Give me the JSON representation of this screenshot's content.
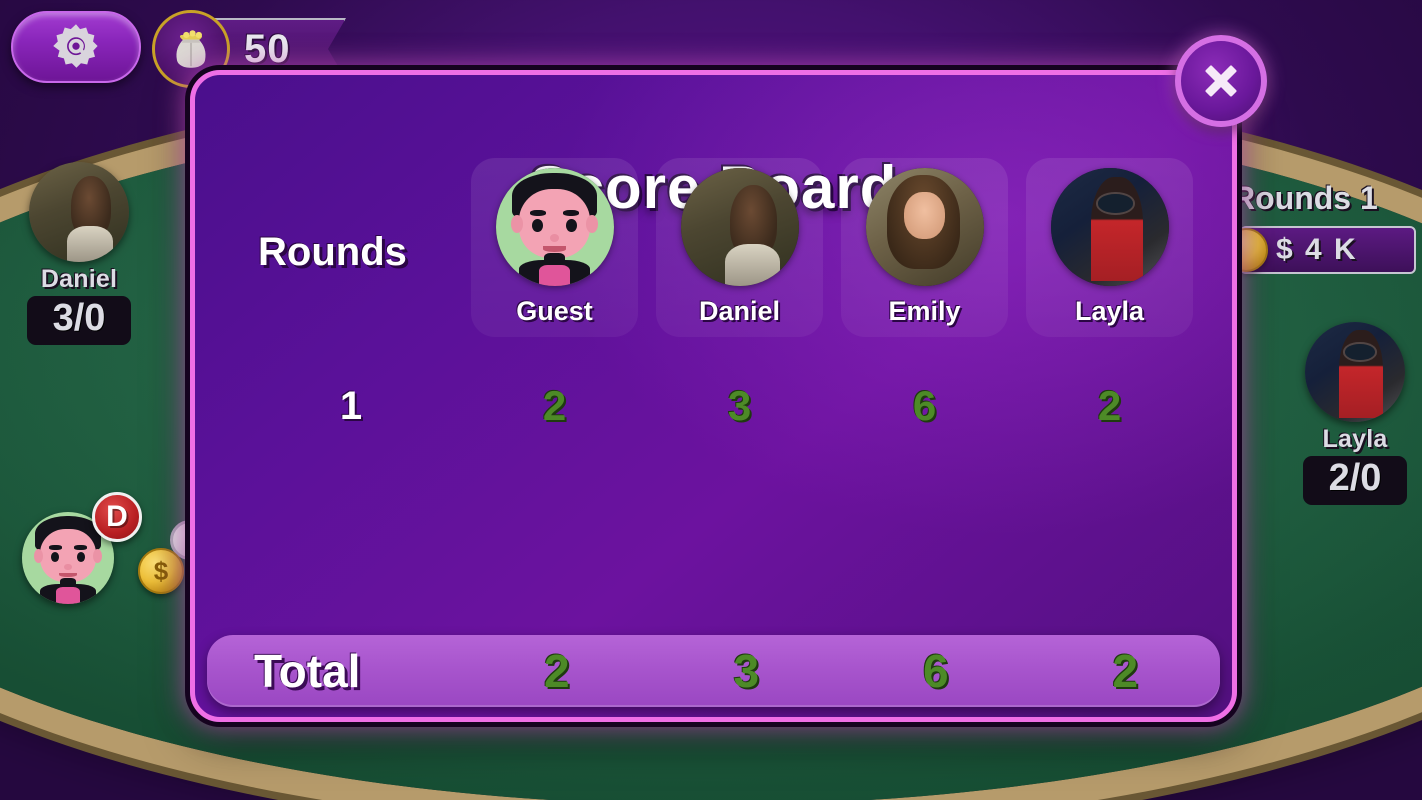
{
  "hud": {
    "settings_icon": "gear-icon",
    "coin_bag_icon": "coin-bag-icon",
    "coin_count": "50",
    "rounds_indicator": "Rounds 1",
    "pot_value": "$ 4 K",
    "pot_coin_icon": "gold-coin-icon",
    "dealer_badge": "D",
    "players": [
      {
        "name": "Daniel",
        "score": "3/0",
        "avatar": "av-daniel",
        "position": "left"
      },
      {
        "name": "Layla",
        "score": "2/0",
        "avatar": "av-layla",
        "position": "right"
      },
      {
        "name": "Guest",
        "score": "",
        "avatar": "av-guest",
        "position": "bottom"
      }
    ],
    "chip_value": "$"
  },
  "dialog": {
    "title": "Score Board",
    "close_icon": "close-icon",
    "rounds_header": "Rounds",
    "total_label": "Total",
    "players": [
      {
        "name": "Guest",
        "avatar": "av-guest"
      },
      {
        "name": "Daniel",
        "avatar": "av-daniel"
      },
      {
        "name": "Emily",
        "avatar": "av-emily"
      },
      {
        "name": "Layla",
        "avatar": "av-layla"
      }
    ],
    "rounds": [
      {
        "label": "1",
        "scores": [
          "2",
          "3",
          "6",
          "2"
        ]
      }
    ],
    "totals": [
      "2",
      "3",
      "6",
      "2"
    ]
  },
  "colors": {
    "dialog_border": "#ef6fe6",
    "dialog_bg": "#5a1199",
    "score_green": "#4d8a27",
    "total_bar": "#a855cd",
    "table_felt": "#1c6642",
    "coin_gold": "#eec03a"
  }
}
